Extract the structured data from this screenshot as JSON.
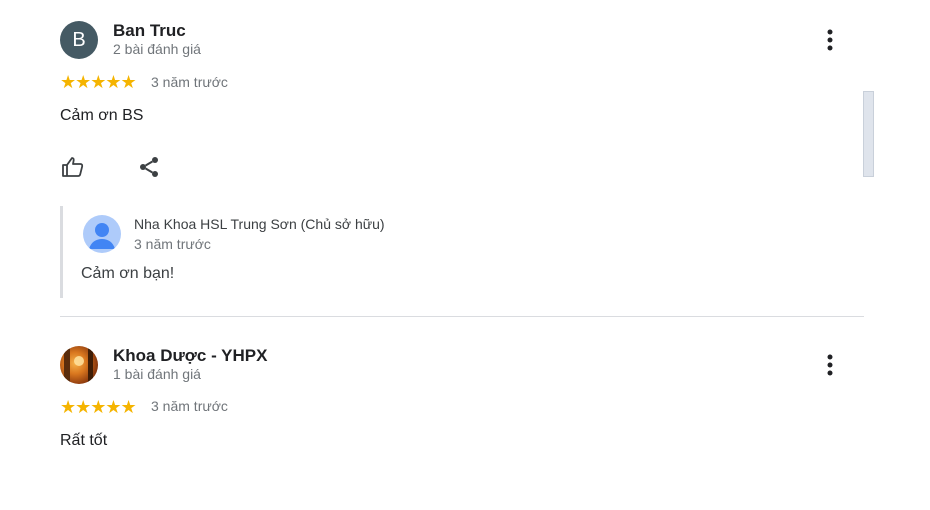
{
  "reviews": [
    {
      "avatar_letter": "B",
      "name": "Ban Truc",
      "review_count": "2 bài đánh giá",
      "stars": "★★★★★",
      "rating": 5,
      "time": "3 năm trước",
      "text": "Cảm ơn BS",
      "reply": {
        "name": "Nha Khoa HSL Trung Sơn (Chủ sở hữu)",
        "time": "3 năm trước",
        "text": "Cảm ơn bạn!"
      }
    },
    {
      "name": "Khoa Dược - YHPX",
      "review_count": "1 bài đánh giá",
      "stars": "★★★★★",
      "rating": 5,
      "time": "3 năm trước",
      "text": "Rất tốt"
    }
  ],
  "icons": {
    "menu": "more-vert-icon",
    "like": "thumb-up-icon",
    "share": "share-icon",
    "owner_avatar": "person-icon"
  },
  "colors": {
    "star": "#f5b400",
    "letter_avatar_bg": "#455a64",
    "owner_avatar_bg": "#aecbfa",
    "owner_avatar_fg": "#4285f4"
  }
}
